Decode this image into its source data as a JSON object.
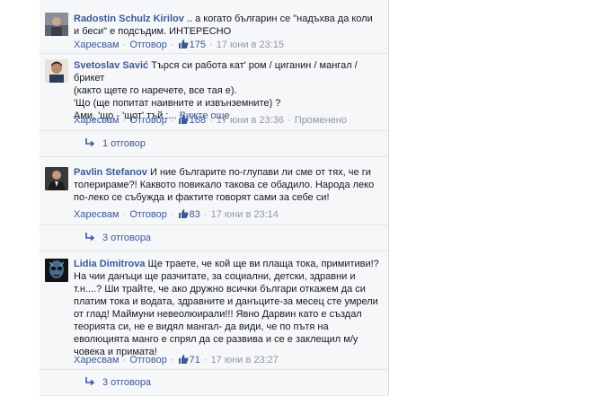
{
  "comments": [
    {
      "author": "Radostin Schulz Kirilov",
      "text": ".. а когато българин се \"надъхва да коли и беси\" е подсъдим. ИНТЕРЕСНО",
      "like_label": "Харесвам",
      "reply_label": "Отговор",
      "likes": "175",
      "time": "17 юни в 23:15"
    },
    {
      "author": "Svetoslav Savić",
      "line1": "Търся си работа кат' ром / циганин / мангал / брикет",
      "line2": "(както щете го наречете, все тая е).",
      "line3": "'Що (ще попитат наивните и извънземните) ?",
      "line4": "Ами, 'що - 'щот' тъй :...",
      "see_more": "Вижте още",
      "like_label": "Харесвам",
      "reply_label": "Отговор",
      "likes": "168",
      "time": "17 юни в 23:36",
      "edited": "Променено",
      "replies": "1 отговор"
    },
    {
      "author": "Pavlin Stefanov",
      "text": "И ние българите по-глупави ли сме от тях, че ги толерираме?! Каквото повикало такова се обадило. Народа леко по-леко се събужда и фактите говорят сами за себе си!",
      "like_label": "Харесвам",
      "reply_label": "Отговор",
      "likes": "83",
      "time": "17 юни в 23:14",
      "replies": "3 отговора"
    },
    {
      "author": "Lidia Dimitrova",
      "text": "Ще траете, че кой ще ви плаща тока, примитиви!?На чии данъци ще разчитате, за социални, детски, здравни и т.н....? Ши трайте, че ако дружно всички българи откажем да си платим тока и водата, здравните и данъците-за месец сте умрели от глад! Маймуни невеолюирали!!! Явно Дарвин като е създал теорията си, не е видял мангал- да види, че по пътя на еволюцията манго е спрял да се развива и се е заклещил м/у човека и примата!",
      "like_label": "Харесвам",
      "reply_label": "Отговор",
      "likes": "71",
      "time": "17 юни в 23:27",
      "replies": "3 отговора"
    }
  ],
  "colors": {
    "link": "#3b5998",
    "meta": "#9197a3",
    "background": "#f6f7f8",
    "divider": "#e5e5e5"
  }
}
